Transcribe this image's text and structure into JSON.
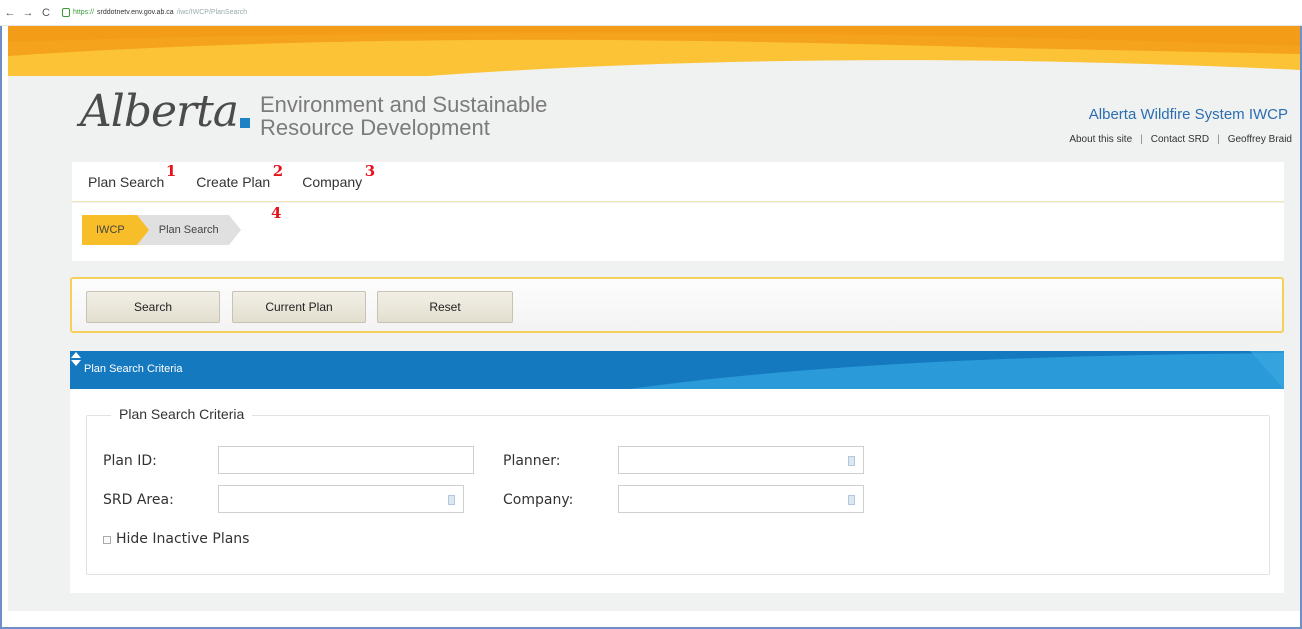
{
  "browser": {
    "url_scheme": "https://",
    "url_host": "srddotnetv.env.gov.ab.ca",
    "url_path": "/iwc/IWCP/PlanSearch"
  },
  "header": {
    "logo_text": "Alberta",
    "dept_line1": "Environment and Sustainable",
    "dept_line2": "Resource Development",
    "system_name": "Alberta Wildfire System IWCP",
    "links": [
      "About this site",
      "Contact SRD",
      "Geoffrey Braid"
    ]
  },
  "menu": {
    "items": [
      "Plan Search",
      "Create Plan",
      "Company"
    ],
    "annotations": [
      "1",
      "2",
      "3"
    ]
  },
  "breadcrumb": {
    "items": [
      "IWCP",
      "Plan Search"
    ],
    "annotation": "4"
  },
  "toolbar": {
    "search_label": "Search",
    "current_plan_label": "Current Plan",
    "reset_label": "Reset"
  },
  "panel": {
    "title": "Plan Search Criteria",
    "legend": "Plan Search Criteria",
    "plan_id_label": "Plan ID:",
    "plan_id_value": "",
    "planner_label": "Planner:",
    "planner_value": "",
    "srd_area_label": "SRD Area:",
    "srd_area_value": "",
    "company_label": "Company:",
    "company_value": "",
    "hide_inactive_label": "Hide Inactive Plans",
    "hide_inactive_checked": false
  },
  "colors": {
    "banner": "#f6a61f",
    "panel_header": "#1579c0",
    "breadcrumb_active": "#f8be2a",
    "system_name": "#2c6fb1",
    "annotation": "#e8101a"
  },
  "icons": [
    "back-arrow-icon",
    "forward-arrow-icon",
    "reload-icon",
    "lock-icon",
    "collapse-toggle-icon"
  ]
}
